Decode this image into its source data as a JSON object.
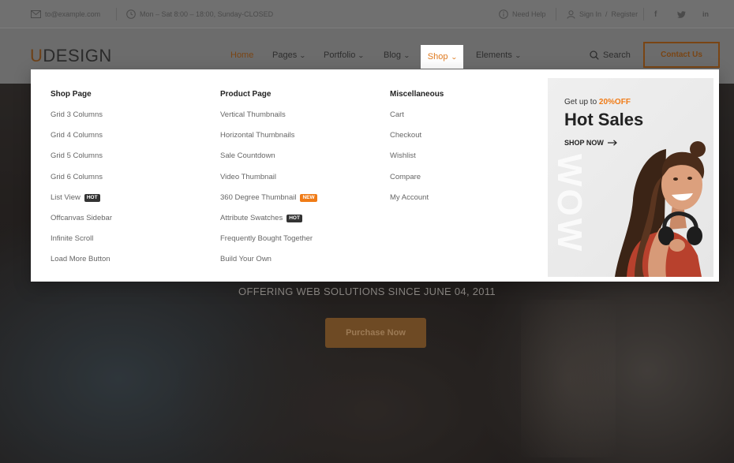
{
  "topbar": {
    "email": "to@example.com",
    "hours": "Mon – Sat 8:00 – 18:00, Sunday-CLOSED",
    "help": "Need Help",
    "signin": "Sign In",
    "slash": "/",
    "register": "Register",
    "social": [
      "f",
      "t",
      "in"
    ]
  },
  "header": {
    "logo_first": "U",
    "logo_rest": "DESIGN",
    "nav": [
      "Home",
      "Pages",
      "Portfolio",
      "Blog",
      "Shop",
      "Elements"
    ],
    "search_label": "Search",
    "contact_label": "Contact Us"
  },
  "mega_menu": {
    "columns": [
      {
        "heading": "Shop Page",
        "items": [
          {
            "label": "Grid 3 Columns",
            "badge": ""
          },
          {
            "label": "Grid 4 Columns",
            "badge": ""
          },
          {
            "label": "Grid 5 Columns",
            "badge": ""
          },
          {
            "label": "Grid 6 Columns",
            "badge": ""
          },
          {
            "label": "List View",
            "badge": "HOT"
          },
          {
            "label": "Offcanvas Sidebar",
            "badge": ""
          },
          {
            "label": "Infinite Scroll",
            "badge": ""
          },
          {
            "label": "Load More Button",
            "badge": ""
          }
        ]
      },
      {
        "heading": "Product Page",
        "items": [
          {
            "label": "Vertical Thumbnails",
            "badge": ""
          },
          {
            "label": "Horizontal Thumbnails",
            "badge": ""
          },
          {
            "label": "Sale Countdown",
            "badge": ""
          },
          {
            "label": "Video Thumbnail",
            "badge": ""
          },
          {
            "label": "360 Degree Thumbnail",
            "badge": "NEW"
          },
          {
            "label": "Attribute Swatches",
            "badge": "HOT"
          },
          {
            "label": "Frequently Bought Together",
            "badge": ""
          },
          {
            "label": "Build Your Own",
            "badge": ""
          }
        ]
      },
      {
        "heading": "Miscellaneous",
        "items": [
          {
            "label": "Cart",
            "badge": ""
          },
          {
            "label": "Checkout",
            "badge": ""
          },
          {
            "label": "Wishlist",
            "badge": ""
          },
          {
            "label": "Compare",
            "badge": ""
          },
          {
            "label": "My Account",
            "badge": ""
          }
        ]
      }
    ],
    "promo": {
      "kicker": "Get up to",
      "discount": "20%OFF",
      "title": "Hot Sales",
      "cta": "SHOP NOW",
      "watermark": "WOW"
    }
  },
  "hero": {
    "tagline": "OFFERING WEB SOLUTIONS SINCE JUNE 04, 2011",
    "button": "Purchase Now"
  },
  "colors": {
    "accent": "#f07b16",
    "dark": "#222222"
  }
}
